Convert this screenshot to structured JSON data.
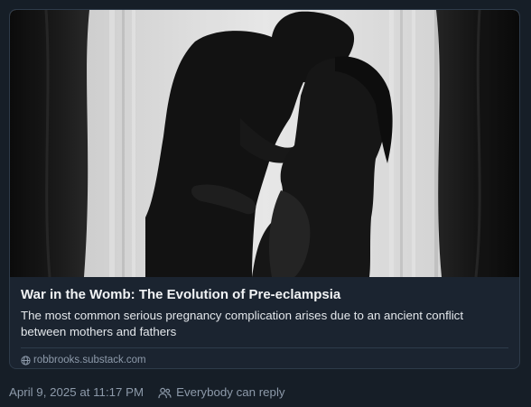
{
  "link_card": {
    "title": "War in the Womb: The Evolution of Pre-eclampsia",
    "description": "The most common serious pregnancy complication arises due to an ancient conflict between mothers and fathers",
    "domain": "robbrooks.substack.com",
    "domain_icon": "globe-icon",
    "image_subject": "black-and-white silhouette of a man kissing a pregnant woman in front of a curtained window"
  },
  "post_meta": {
    "timestamp": "April 9, 2025 at 11:17 PM",
    "reply_setting": "Everybody can reply",
    "reply_icon": "people-icon"
  },
  "colors": {
    "background": "#161e27",
    "card_border": "#2e3b4a",
    "title_text": "#f1f3f5",
    "muted_text": "#8d9aaa"
  }
}
